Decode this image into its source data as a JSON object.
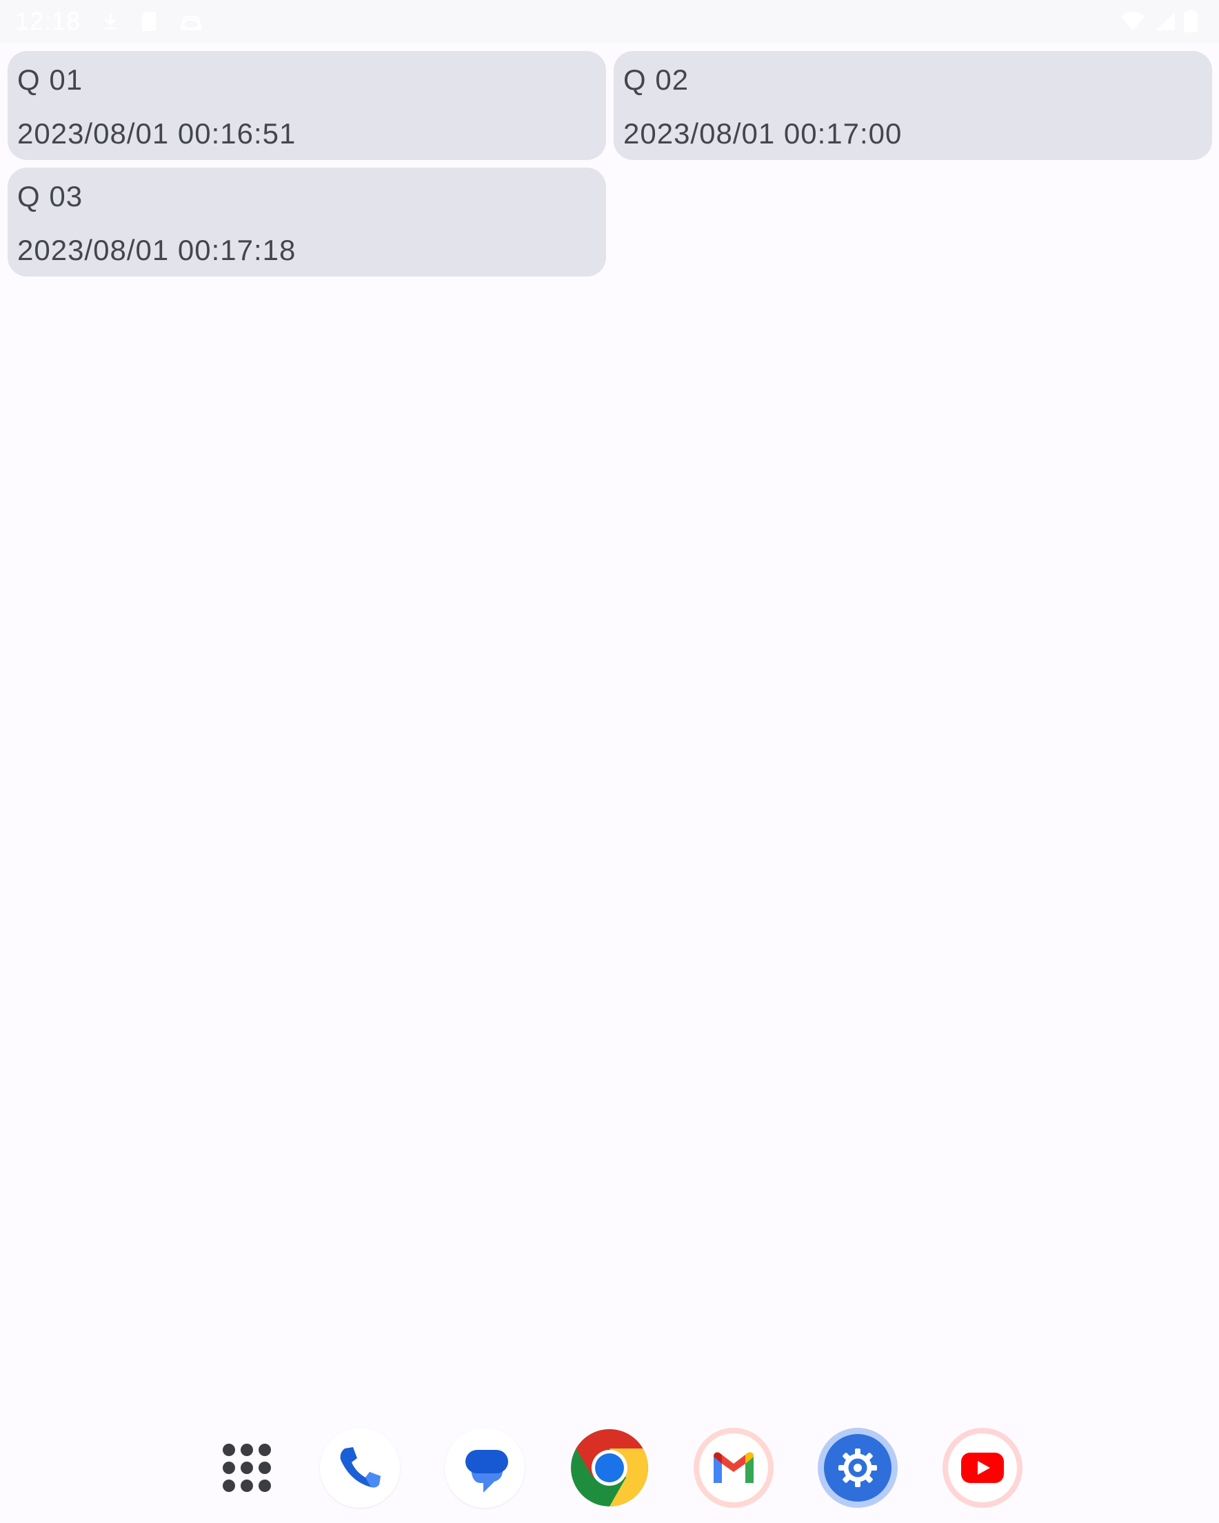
{
  "status_bar": {
    "time": "12:18",
    "left_icons": [
      "download-icon",
      "sd-card-icon",
      "android-face-icon"
    ],
    "right_icons": [
      "wifi-icon",
      "cell-signal-icon",
      "battery-icon"
    ]
  },
  "cards": [
    {
      "title": "Q 01",
      "timestamp": "2023/08/01 00:16:51"
    },
    {
      "title": "Q 02",
      "timestamp": "2023/08/01 00:17:00"
    },
    {
      "title": "Q 03",
      "timestamp": "2023/08/01 00:17:18"
    }
  ],
  "dock": {
    "apps": [
      "app-drawer-icon",
      "phone-icon",
      "messages-icon",
      "chrome-icon",
      "gmail-icon",
      "settings-icon",
      "youtube-icon"
    ]
  },
  "colors": {
    "background": "#fdfbff",
    "card": "#e3e3ec",
    "text": "#44464f"
  }
}
